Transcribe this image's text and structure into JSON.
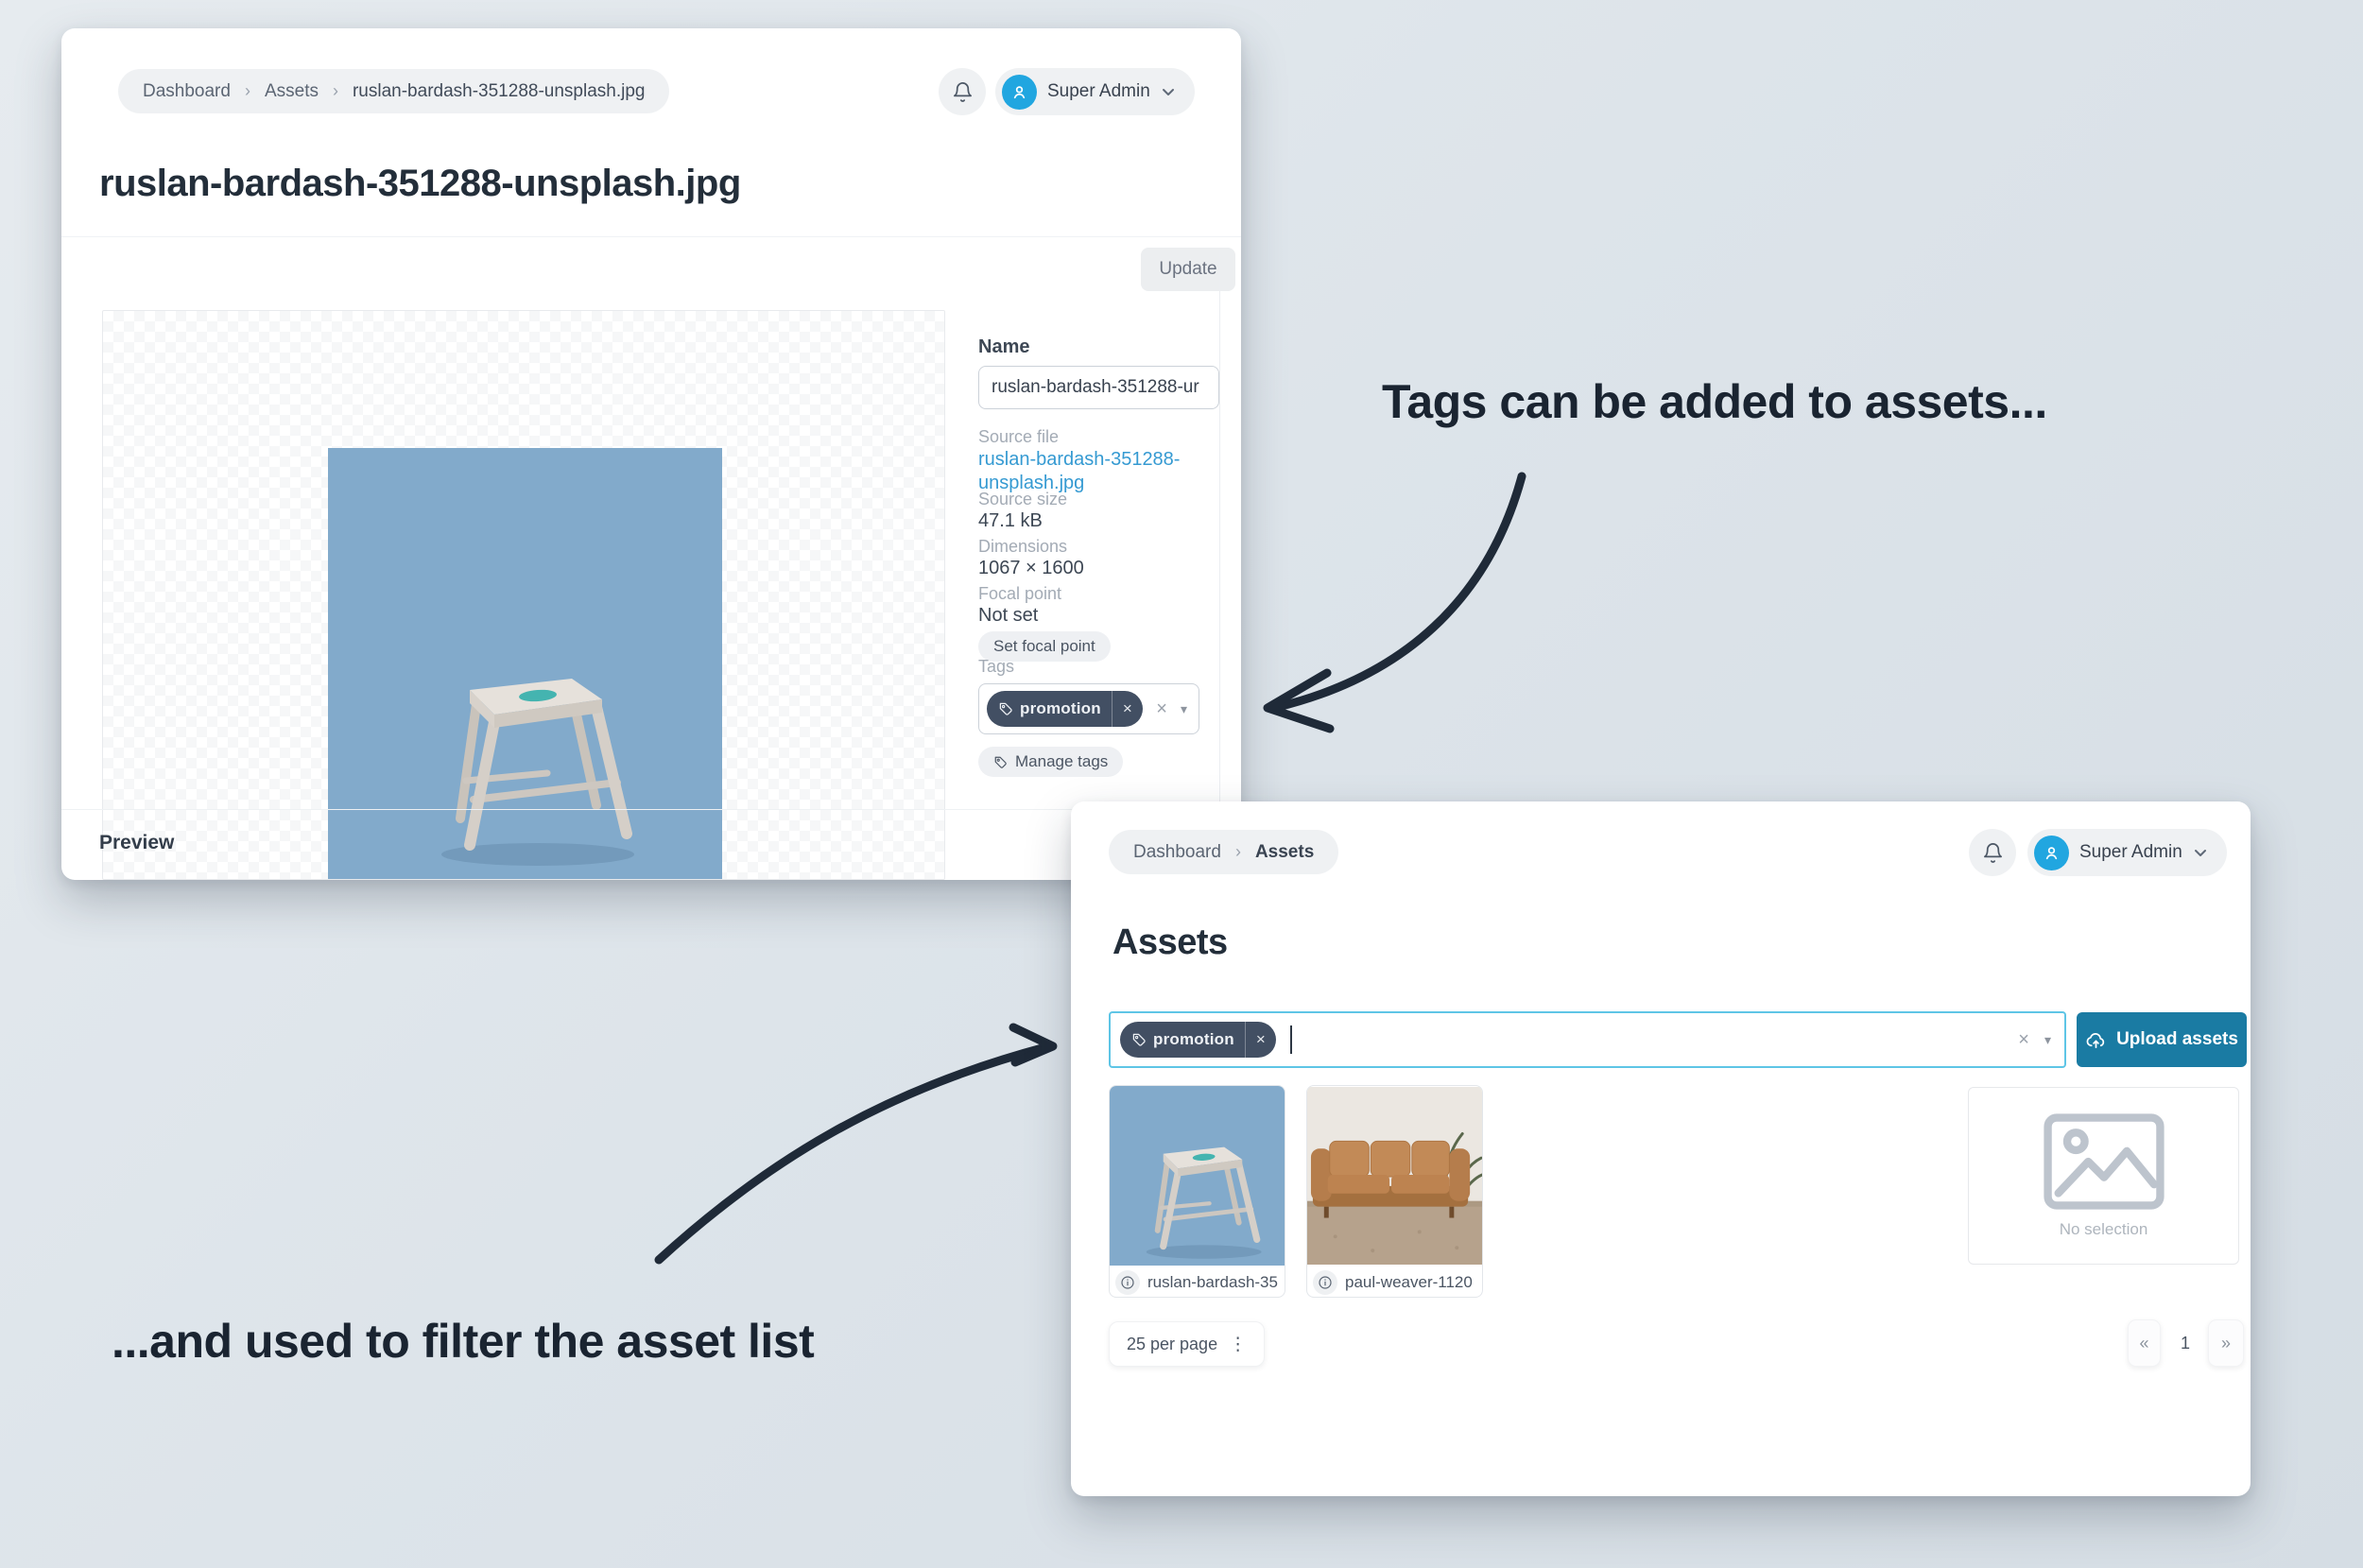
{
  "icons": {
    "breadcrumb_separator": "›",
    "close": "×",
    "caret_down": "▾",
    "kebab": "⋮",
    "pagination_prev": "«",
    "pagination_next": "»"
  },
  "annotations": {
    "tags_note": "Tags can be added to assets...",
    "filter_note": "...and used to filter the asset list"
  },
  "detail_window": {
    "breadcrumbs": [
      {
        "label": "Dashboard"
      },
      {
        "label": "Assets"
      },
      {
        "label": "ruslan-bardash-351288-unsplash.jpg"
      }
    ],
    "user": {
      "name": "Super Admin"
    },
    "title": "ruslan-bardash-351288-unsplash.jpg",
    "actions": {
      "update": "Update"
    },
    "sidebar": {
      "name_label": "Name",
      "name_value": "ruslan-bardash-351288-ur",
      "source_file_label": "Source file",
      "source_file_link": "ruslan-bardash-351288-unsplash.jpg",
      "source_size_label": "Source size",
      "source_size_value": "47.1 kB",
      "dimensions_label": "Dimensions",
      "dimensions_value": "1067 × 1600",
      "focal_point_label": "Focal point",
      "focal_point_value": "Not set",
      "set_focal_point_button": "Set focal point",
      "tags_label": "Tags",
      "tags": [
        {
          "label": "promotion"
        }
      ],
      "manage_tags_button": "Manage tags"
    },
    "preview_section_title": "Preview"
  },
  "list_window": {
    "breadcrumbs": [
      {
        "label": "Dashboard"
      },
      {
        "label": "Assets"
      }
    ],
    "user": {
      "name": "Super Admin"
    },
    "title": "Assets",
    "filter_tags": [
      {
        "label": "promotion"
      }
    ],
    "upload_button": "Upload assets",
    "assets": [
      {
        "filename": "ruslan-bardash-35"
      },
      {
        "filename": "paul-weaver-1120"
      }
    ],
    "no_selection_label": "No selection",
    "per_page_label": "25 per page",
    "pagination": {
      "current_page": "1"
    }
  }
}
